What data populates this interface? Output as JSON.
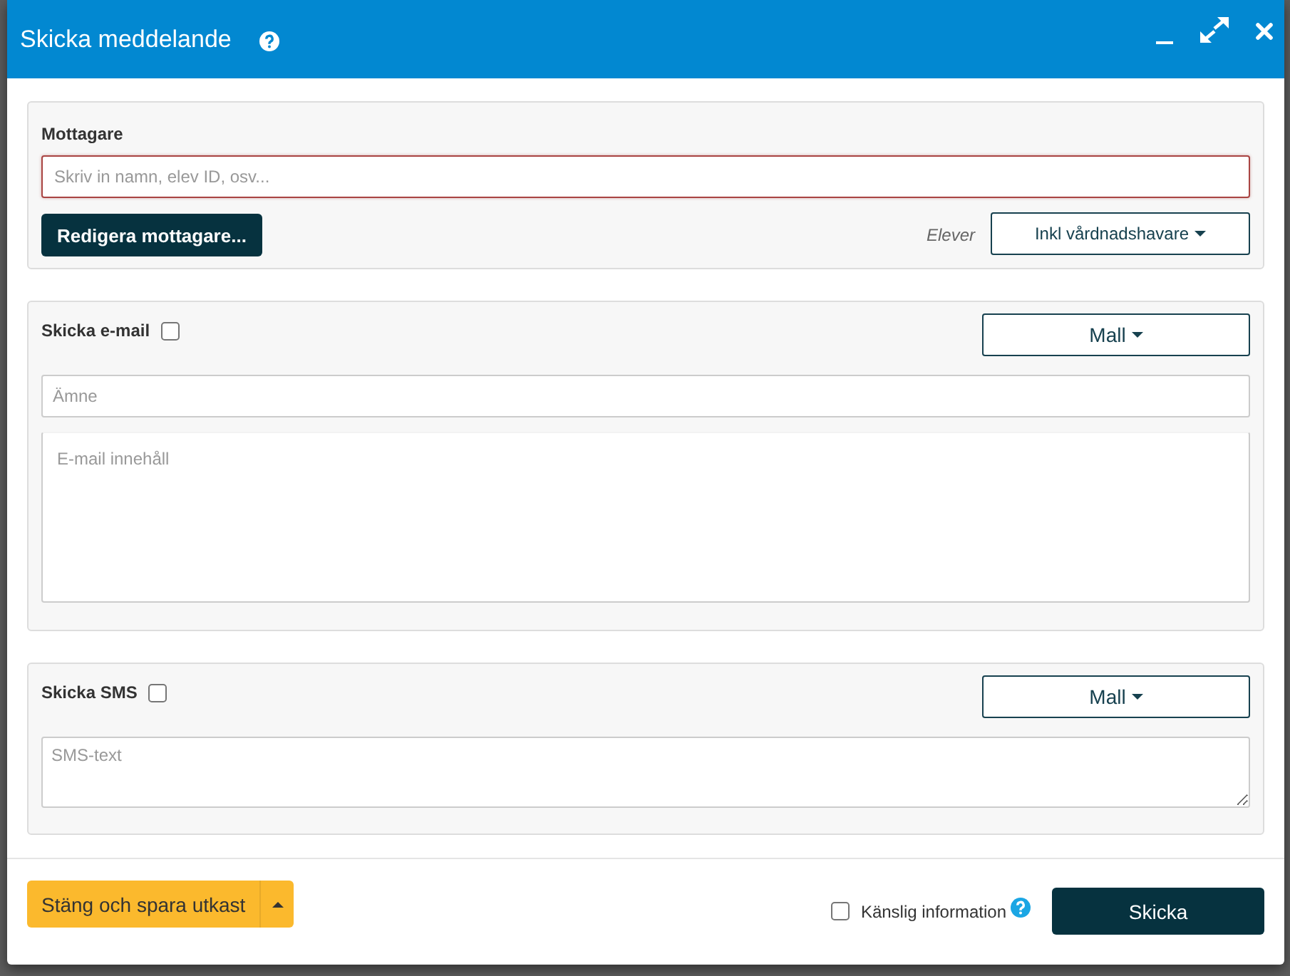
{
  "window": {
    "title": "Skicka meddelande"
  },
  "recipients": {
    "label": "Mottagare",
    "input": {
      "placeholder": "Skriv in namn, elev ID, osv...",
      "invalid": true
    },
    "edit_button": "Redigera mottagare...",
    "group_label": "Elever",
    "group_dropdown": "Inkl vårdnadshavare"
  },
  "email": {
    "label": "Skicka e-mail",
    "checked": false,
    "template_button": "Mall",
    "subject": {
      "placeholder": "Ämne"
    },
    "body": {
      "placeholder": "E-mail innehåll"
    }
  },
  "sms": {
    "label": "Skicka SMS",
    "checked": false,
    "template_button": "Mall",
    "text": {
      "placeholder": "SMS-text"
    }
  },
  "footer": {
    "save_button": "Stäng och spara utkast",
    "sensitive": {
      "label": "Känslig information",
      "checked": false
    },
    "send_button": "Skicka"
  }
}
